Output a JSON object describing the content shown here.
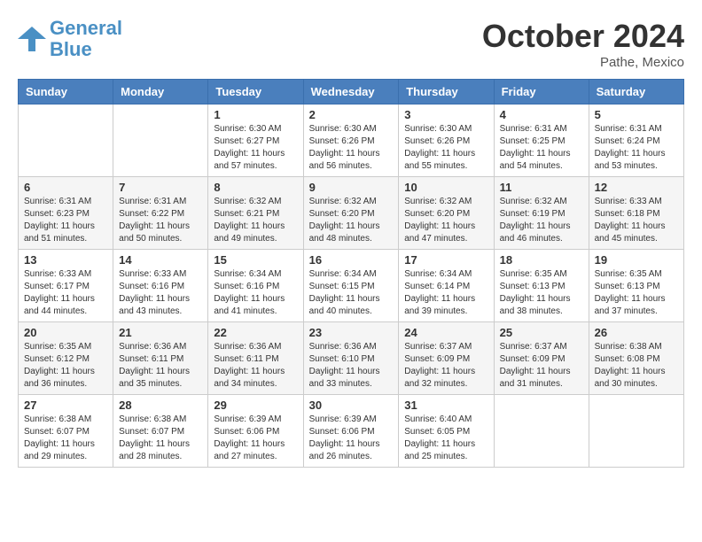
{
  "header": {
    "logo_line1": "General",
    "logo_line2": "Blue",
    "month": "October 2024",
    "location": "Pathe, Mexico"
  },
  "weekdays": [
    "Sunday",
    "Monday",
    "Tuesday",
    "Wednesday",
    "Thursday",
    "Friday",
    "Saturday"
  ],
  "weeks": [
    [
      {
        "day": "",
        "sunrise": "",
        "sunset": "",
        "daylight": ""
      },
      {
        "day": "",
        "sunrise": "",
        "sunset": "",
        "daylight": ""
      },
      {
        "day": "1",
        "sunrise": "Sunrise: 6:30 AM",
        "sunset": "Sunset: 6:27 PM",
        "daylight": "Daylight: 11 hours and 57 minutes."
      },
      {
        "day": "2",
        "sunrise": "Sunrise: 6:30 AM",
        "sunset": "Sunset: 6:26 PM",
        "daylight": "Daylight: 11 hours and 56 minutes."
      },
      {
        "day": "3",
        "sunrise": "Sunrise: 6:30 AM",
        "sunset": "Sunset: 6:26 PM",
        "daylight": "Daylight: 11 hours and 55 minutes."
      },
      {
        "day": "4",
        "sunrise": "Sunrise: 6:31 AM",
        "sunset": "Sunset: 6:25 PM",
        "daylight": "Daylight: 11 hours and 54 minutes."
      },
      {
        "day": "5",
        "sunrise": "Sunrise: 6:31 AM",
        "sunset": "Sunset: 6:24 PM",
        "daylight": "Daylight: 11 hours and 53 minutes."
      }
    ],
    [
      {
        "day": "6",
        "sunrise": "Sunrise: 6:31 AM",
        "sunset": "Sunset: 6:23 PM",
        "daylight": "Daylight: 11 hours and 51 minutes."
      },
      {
        "day": "7",
        "sunrise": "Sunrise: 6:31 AM",
        "sunset": "Sunset: 6:22 PM",
        "daylight": "Daylight: 11 hours and 50 minutes."
      },
      {
        "day": "8",
        "sunrise": "Sunrise: 6:32 AM",
        "sunset": "Sunset: 6:21 PM",
        "daylight": "Daylight: 11 hours and 49 minutes."
      },
      {
        "day": "9",
        "sunrise": "Sunrise: 6:32 AM",
        "sunset": "Sunset: 6:20 PM",
        "daylight": "Daylight: 11 hours and 48 minutes."
      },
      {
        "day": "10",
        "sunrise": "Sunrise: 6:32 AM",
        "sunset": "Sunset: 6:20 PM",
        "daylight": "Daylight: 11 hours and 47 minutes."
      },
      {
        "day": "11",
        "sunrise": "Sunrise: 6:32 AM",
        "sunset": "Sunset: 6:19 PM",
        "daylight": "Daylight: 11 hours and 46 minutes."
      },
      {
        "day": "12",
        "sunrise": "Sunrise: 6:33 AM",
        "sunset": "Sunset: 6:18 PM",
        "daylight": "Daylight: 11 hours and 45 minutes."
      }
    ],
    [
      {
        "day": "13",
        "sunrise": "Sunrise: 6:33 AM",
        "sunset": "Sunset: 6:17 PM",
        "daylight": "Daylight: 11 hours and 44 minutes."
      },
      {
        "day": "14",
        "sunrise": "Sunrise: 6:33 AM",
        "sunset": "Sunset: 6:16 PM",
        "daylight": "Daylight: 11 hours and 43 minutes."
      },
      {
        "day": "15",
        "sunrise": "Sunrise: 6:34 AM",
        "sunset": "Sunset: 6:16 PM",
        "daylight": "Daylight: 11 hours and 41 minutes."
      },
      {
        "day": "16",
        "sunrise": "Sunrise: 6:34 AM",
        "sunset": "Sunset: 6:15 PM",
        "daylight": "Daylight: 11 hours and 40 minutes."
      },
      {
        "day": "17",
        "sunrise": "Sunrise: 6:34 AM",
        "sunset": "Sunset: 6:14 PM",
        "daylight": "Daylight: 11 hours and 39 minutes."
      },
      {
        "day": "18",
        "sunrise": "Sunrise: 6:35 AM",
        "sunset": "Sunset: 6:13 PM",
        "daylight": "Daylight: 11 hours and 38 minutes."
      },
      {
        "day": "19",
        "sunrise": "Sunrise: 6:35 AM",
        "sunset": "Sunset: 6:13 PM",
        "daylight": "Daylight: 11 hours and 37 minutes."
      }
    ],
    [
      {
        "day": "20",
        "sunrise": "Sunrise: 6:35 AM",
        "sunset": "Sunset: 6:12 PM",
        "daylight": "Daylight: 11 hours and 36 minutes."
      },
      {
        "day": "21",
        "sunrise": "Sunrise: 6:36 AM",
        "sunset": "Sunset: 6:11 PM",
        "daylight": "Daylight: 11 hours and 35 minutes."
      },
      {
        "day": "22",
        "sunrise": "Sunrise: 6:36 AM",
        "sunset": "Sunset: 6:11 PM",
        "daylight": "Daylight: 11 hours and 34 minutes."
      },
      {
        "day": "23",
        "sunrise": "Sunrise: 6:36 AM",
        "sunset": "Sunset: 6:10 PM",
        "daylight": "Daylight: 11 hours and 33 minutes."
      },
      {
        "day": "24",
        "sunrise": "Sunrise: 6:37 AM",
        "sunset": "Sunset: 6:09 PM",
        "daylight": "Daylight: 11 hours and 32 minutes."
      },
      {
        "day": "25",
        "sunrise": "Sunrise: 6:37 AM",
        "sunset": "Sunset: 6:09 PM",
        "daylight": "Daylight: 11 hours and 31 minutes."
      },
      {
        "day": "26",
        "sunrise": "Sunrise: 6:38 AM",
        "sunset": "Sunset: 6:08 PM",
        "daylight": "Daylight: 11 hours and 30 minutes."
      }
    ],
    [
      {
        "day": "27",
        "sunrise": "Sunrise: 6:38 AM",
        "sunset": "Sunset: 6:07 PM",
        "daylight": "Daylight: 11 hours and 29 minutes."
      },
      {
        "day": "28",
        "sunrise": "Sunrise: 6:38 AM",
        "sunset": "Sunset: 6:07 PM",
        "daylight": "Daylight: 11 hours and 28 minutes."
      },
      {
        "day": "29",
        "sunrise": "Sunrise: 6:39 AM",
        "sunset": "Sunset: 6:06 PM",
        "daylight": "Daylight: 11 hours and 27 minutes."
      },
      {
        "day": "30",
        "sunrise": "Sunrise: 6:39 AM",
        "sunset": "Sunset: 6:06 PM",
        "daylight": "Daylight: 11 hours and 26 minutes."
      },
      {
        "day": "31",
        "sunrise": "Sunrise: 6:40 AM",
        "sunset": "Sunset: 6:05 PM",
        "daylight": "Daylight: 11 hours and 25 minutes."
      },
      {
        "day": "",
        "sunrise": "",
        "sunset": "",
        "daylight": ""
      },
      {
        "day": "",
        "sunrise": "",
        "sunset": "",
        "daylight": ""
      }
    ]
  ]
}
